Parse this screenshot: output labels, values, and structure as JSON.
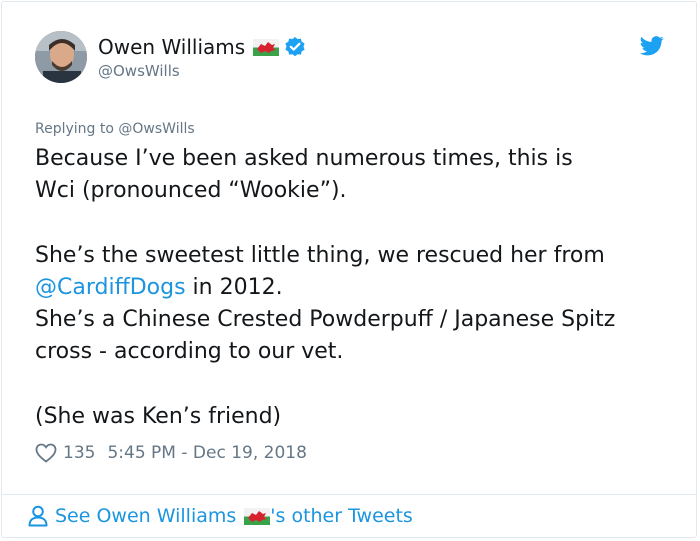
{
  "author": {
    "name": "Owen Williams",
    "handle": "@OwsWills"
  },
  "reply": {
    "prefix": "Replying to",
    "target": "@OwsWills"
  },
  "tweet": {
    "line1": "Because I’ve been asked numerous times, this is",
    "line2": "Wci (pronounced “Wookie”).",
    "line3": "She’s the sweetest little thing, we rescued her from",
    "mention": "@CardiffDogs",
    "line4_suffix": " in 2012.",
    "line5": "She’s a Chinese Crested Powderpuff / Japanese Spitz",
    "line6": "cross - according to our vet.",
    "line7": "(She was Ken’s friend)"
  },
  "meta": {
    "likes": "135",
    "timestamp": "5:45 PM - Dec 19, 2018"
  },
  "footer": {
    "prefix": "See Owen Williams",
    "suffix": "'s other Tweets"
  },
  "colors": {
    "accent": "#1b95e0",
    "muted": "#657786",
    "text": "#14171a"
  },
  "icons": [
    "wales-flag-icon",
    "verified-badge-icon",
    "twitter-bird-icon",
    "heart-icon",
    "person-icon"
  ]
}
